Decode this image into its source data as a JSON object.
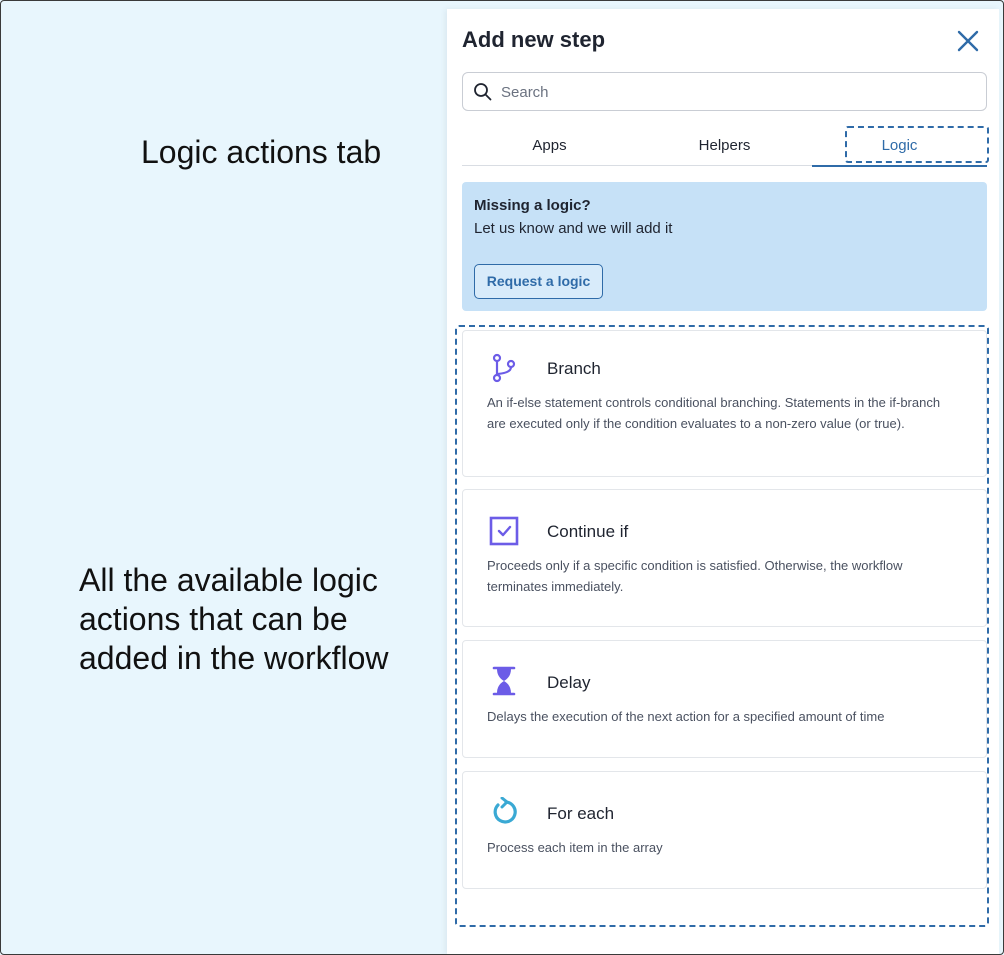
{
  "annotations": {
    "tab_note": "Logic actions tab",
    "list_note": "All the available logic actions that can be added in the workflow"
  },
  "panel": {
    "title": "Add new step",
    "close_icon": "close-icon",
    "search": {
      "placeholder": "Search",
      "value": "",
      "icon": "search-icon"
    },
    "tabs": [
      {
        "label": "Apps",
        "active": false
      },
      {
        "label": "Helpers",
        "active": false
      },
      {
        "label": "Logic",
        "active": true
      }
    ],
    "banner": {
      "title": "Missing a logic?",
      "text": "Let us know and we will add it",
      "button_label": "Request a logic"
    },
    "logic_actions": [
      {
        "title": "Branch",
        "icon": "branch-icon",
        "description": "An if-else statement controls conditional branching. Statements in the if-branch are executed only if the condition evaluates to a non-zero value (or true)."
      },
      {
        "title": "Continue if",
        "icon": "checkbox-icon",
        "description": "Proceeds only if a specific condition is satisfied. Otherwise, the workflow terminates immediately."
      },
      {
        "title": "Delay",
        "icon": "hourglass-icon",
        "description": "Delays the execution of the next action for a specified amount of time"
      },
      {
        "title": "For each",
        "icon": "loop-icon",
        "description": "Process each item in the array"
      }
    ]
  },
  "colors": {
    "background": "#e8f6fd",
    "accent": "#2f6ba8",
    "banner": "#c6e1f7",
    "icon_purple": "#6c5ce7",
    "icon_teal": "#3aa9d4"
  }
}
